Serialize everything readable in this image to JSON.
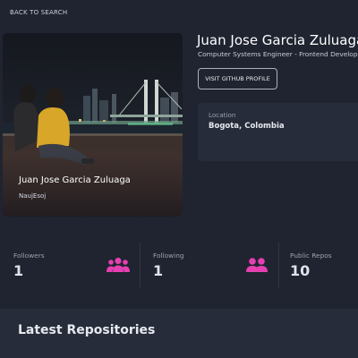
{
  "nav": {
    "back_label": "BACK TO SEARCH"
  },
  "profile": {
    "name": "Juan Jose Garcia Zuluaga",
    "bio": "Computer Systems Engineer - Frontend Developer",
    "login": "NaujEsoj",
    "visit_button": "VISIT GITHUB PROFILE",
    "location_label": "Location",
    "location_value": "Bogota, Colombia"
  },
  "stats": [
    {
      "label": "Followers",
      "value": "1",
      "icon": "users-group-icon"
    },
    {
      "label": "Following",
      "value": "1",
      "icon": "users-pair-icon"
    },
    {
      "label": "Public Repos",
      "value": "10"
    }
  ],
  "repos": {
    "title": "Latest Repositories"
  },
  "colors": {
    "background": "#1f2430",
    "card": "#262c39",
    "accent": "#e53fb1"
  }
}
